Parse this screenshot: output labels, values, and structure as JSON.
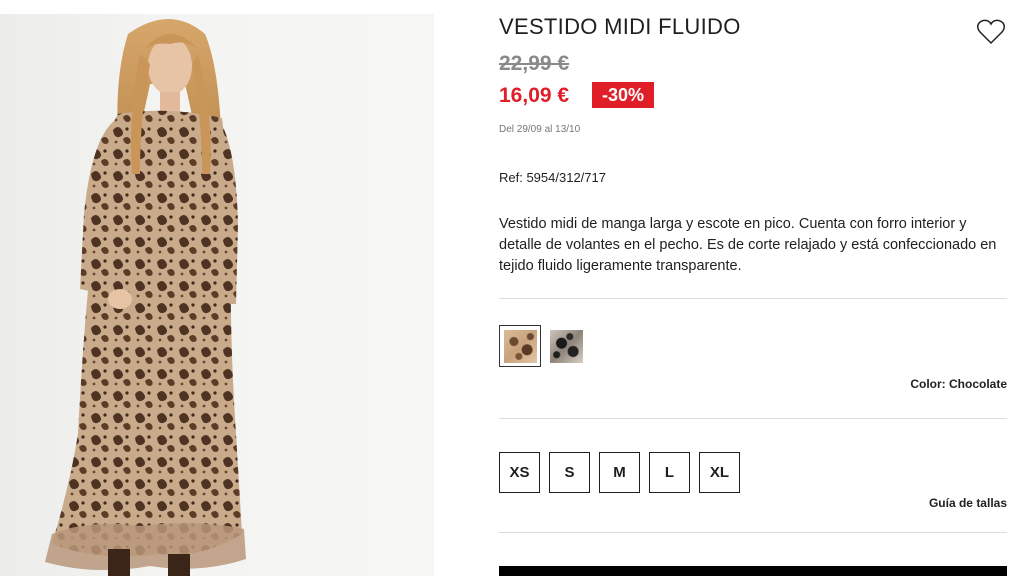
{
  "product": {
    "title": "VESTIDO MIDI FLUIDO",
    "old_price": "22,99 €",
    "new_price": "16,09 €",
    "discount": "-30%",
    "dates": "Del 29/09 al 13/10",
    "ref": "Ref: 5954/312/717",
    "description": "Vestido midi de manga larga y escote en pico. Cuenta con forro interior y detalle de volantes en el pecho. Es de corte relajado y está confeccionado en tejido fluido ligeramente transparente."
  },
  "icons": {
    "favorite": "heart-outline-icon"
  },
  "colors": {
    "label": "Color: Chocolate",
    "swatches": [
      "Chocolate",
      "Dark print"
    ],
    "selected": "Chocolate"
  },
  "sizes": {
    "options": [
      "XS",
      "S",
      "M",
      "L",
      "XL"
    ],
    "guide_label": "Guía de tallas"
  },
  "theme": {
    "sale_red": "#e01e27",
    "text": "#1f1f1f",
    "muted": "#8a8a8a"
  }
}
